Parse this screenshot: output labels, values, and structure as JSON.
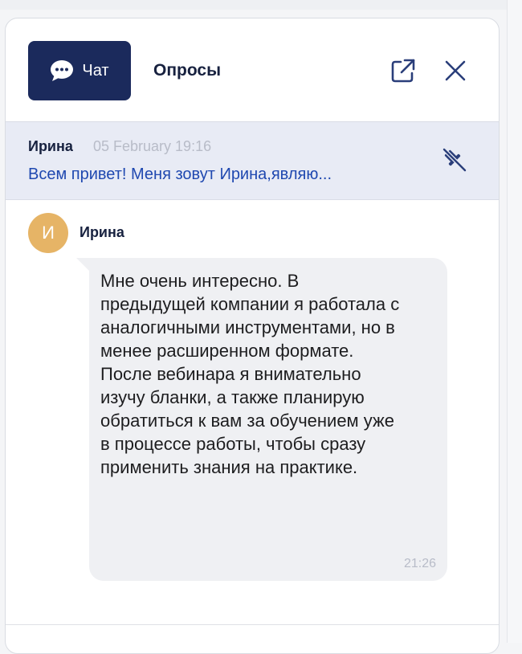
{
  "header": {
    "chat_tab_label": "Чат",
    "polls_tab_label": "Опросы"
  },
  "pinned": {
    "author": "Ирина",
    "time": "05 February 19:16",
    "text": "Всем привет! Меня зовут Ирина,являю..."
  },
  "message": {
    "avatar_letter": "И",
    "author": "Ирина",
    "text": "Мне очень интересно. В предыдущей компании я работала с аналогичными инструментами, но в менее расширенном формате. После вебинара я внимательно изучу бланки, а также планирую обратиться к вам за обучением уже в процессе работы, чтобы сразу применить знания на практике.",
    "time": "21:26"
  },
  "icons": {
    "chat": "chat-bubble-icon",
    "open": "external-link-icon",
    "close": "close-icon",
    "pin": "unpin-icon"
  },
  "colors": {
    "accent_dark": "#1b2a5c",
    "link_blue": "#1f48b0",
    "avatar": "#e6b466",
    "pinned_bg": "#e8ebf5"
  }
}
